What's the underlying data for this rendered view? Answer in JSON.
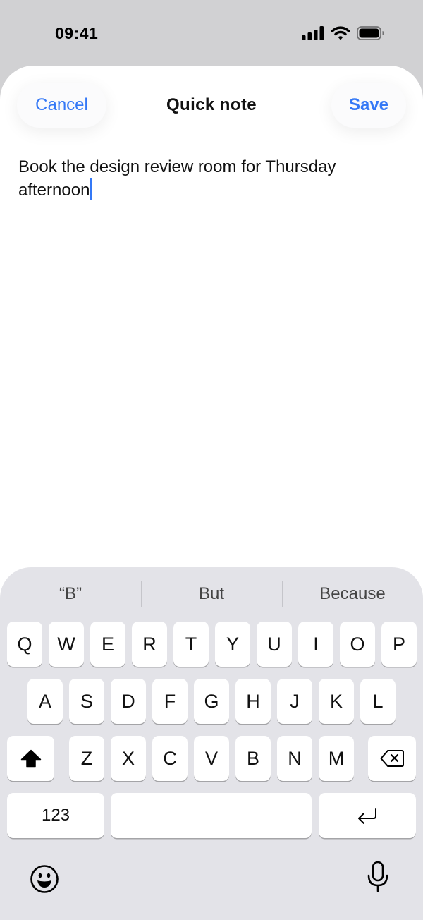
{
  "status_bar": {
    "time": "09:41"
  },
  "sheet": {
    "cancel_label": "Cancel",
    "title": "Quick note",
    "save_label": "Save",
    "note_text": "Book the design review room for Thursday afternoon"
  },
  "keyboard": {
    "suggestions": [
      "“B”",
      "But",
      "Because"
    ],
    "rows": [
      [
        "Q",
        "W",
        "E",
        "R",
        "T",
        "Y",
        "U",
        "I",
        "O",
        "P"
      ],
      [
        "A",
        "S",
        "D",
        "F",
        "G",
        "H",
        "J",
        "K",
        "L"
      ],
      [
        "Z",
        "X",
        "C",
        "V",
        "B",
        "N",
        "M"
      ]
    ],
    "numbers_label": "123",
    "space_label": "",
    "icons": {
      "shift": "shift-icon",
      "delete": "delete-icon",
      "return": "return-icon",
      "emoji": "emoji-icon",
      "microphone": "microphone-icon"
    }
  },
  "colors": {
    "accent": "#3478f6",
    "keyboard_bg": "#e3e3e8",
    "key_bg": "#ffffff",
    "page_bg": "#d1d1d3"
  }
}
